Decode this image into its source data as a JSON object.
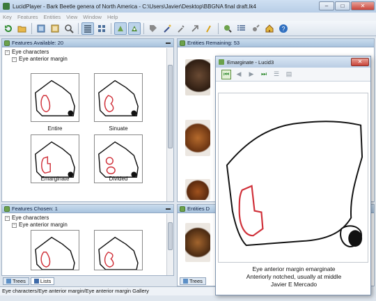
{
  "window": {
    "title": "LucidPlayer - Bark Beetle genera of North America - C:\\Users\\Javier\\Desktop\\BBGNA final draft.lk4",
    "min_label": "–",
    "max_label": "□",
    "close_label": "✕"
  },
  "menu": [
    "Key",
    "Features",
    "Entities",
    "View",
    "Window",
    "Help"
  ],
  "features_available": {
    "header": "Features Available: 20",
    "group": "Eye characters",
    "subgroup": "Eye anterior margin",
    "states": [
      "Entire",
      "Sinuate",
      "Emarginate",
      "Divided"
    ]
  },
  "features_chosen": {
    "header": "Features Chosen: 1",
    "group": "Eye characters",
    "subgroup": "Eye anterior margin"
  },
  "entities_remaining": {
    "header": "Entities Remaining: 53"
  },
  "entities_discarded": {
    "header": "Entities D"
  },
  "tabs": {
    "trees": "Trees",
    "lists": "Lists"
  },
  "status_bar": "Eye characters/Eye anterior margin/Eye anterior margin Gallery",
  "popup": {
    "title": "Emarginate - Lucid3",
    "close_label": "✕",
    "caption_line1": "Eye anterior margin emarginate",
    "caption_line2": "Anteriorly notched, usually at middle",
    "caption_line3": "Javier E Mercado"
  },
  "colors": {
    "accent": "#6da24c",
    "eye_outline": "#d0313a",
    "pane_header": "#b4cbe3"
  },
  "icons": [
    "restart-icon",
    "open-icon",
    "features-icon",
    "entities-icon",
    "search-icon",
    "list-view-icon",
    "gallery-icon",
    "prune-icon",
    "tag-icon",
    "wand-icon",
    "tool-icon",
    "home-icon",
    "help-icon"
  ]
}
